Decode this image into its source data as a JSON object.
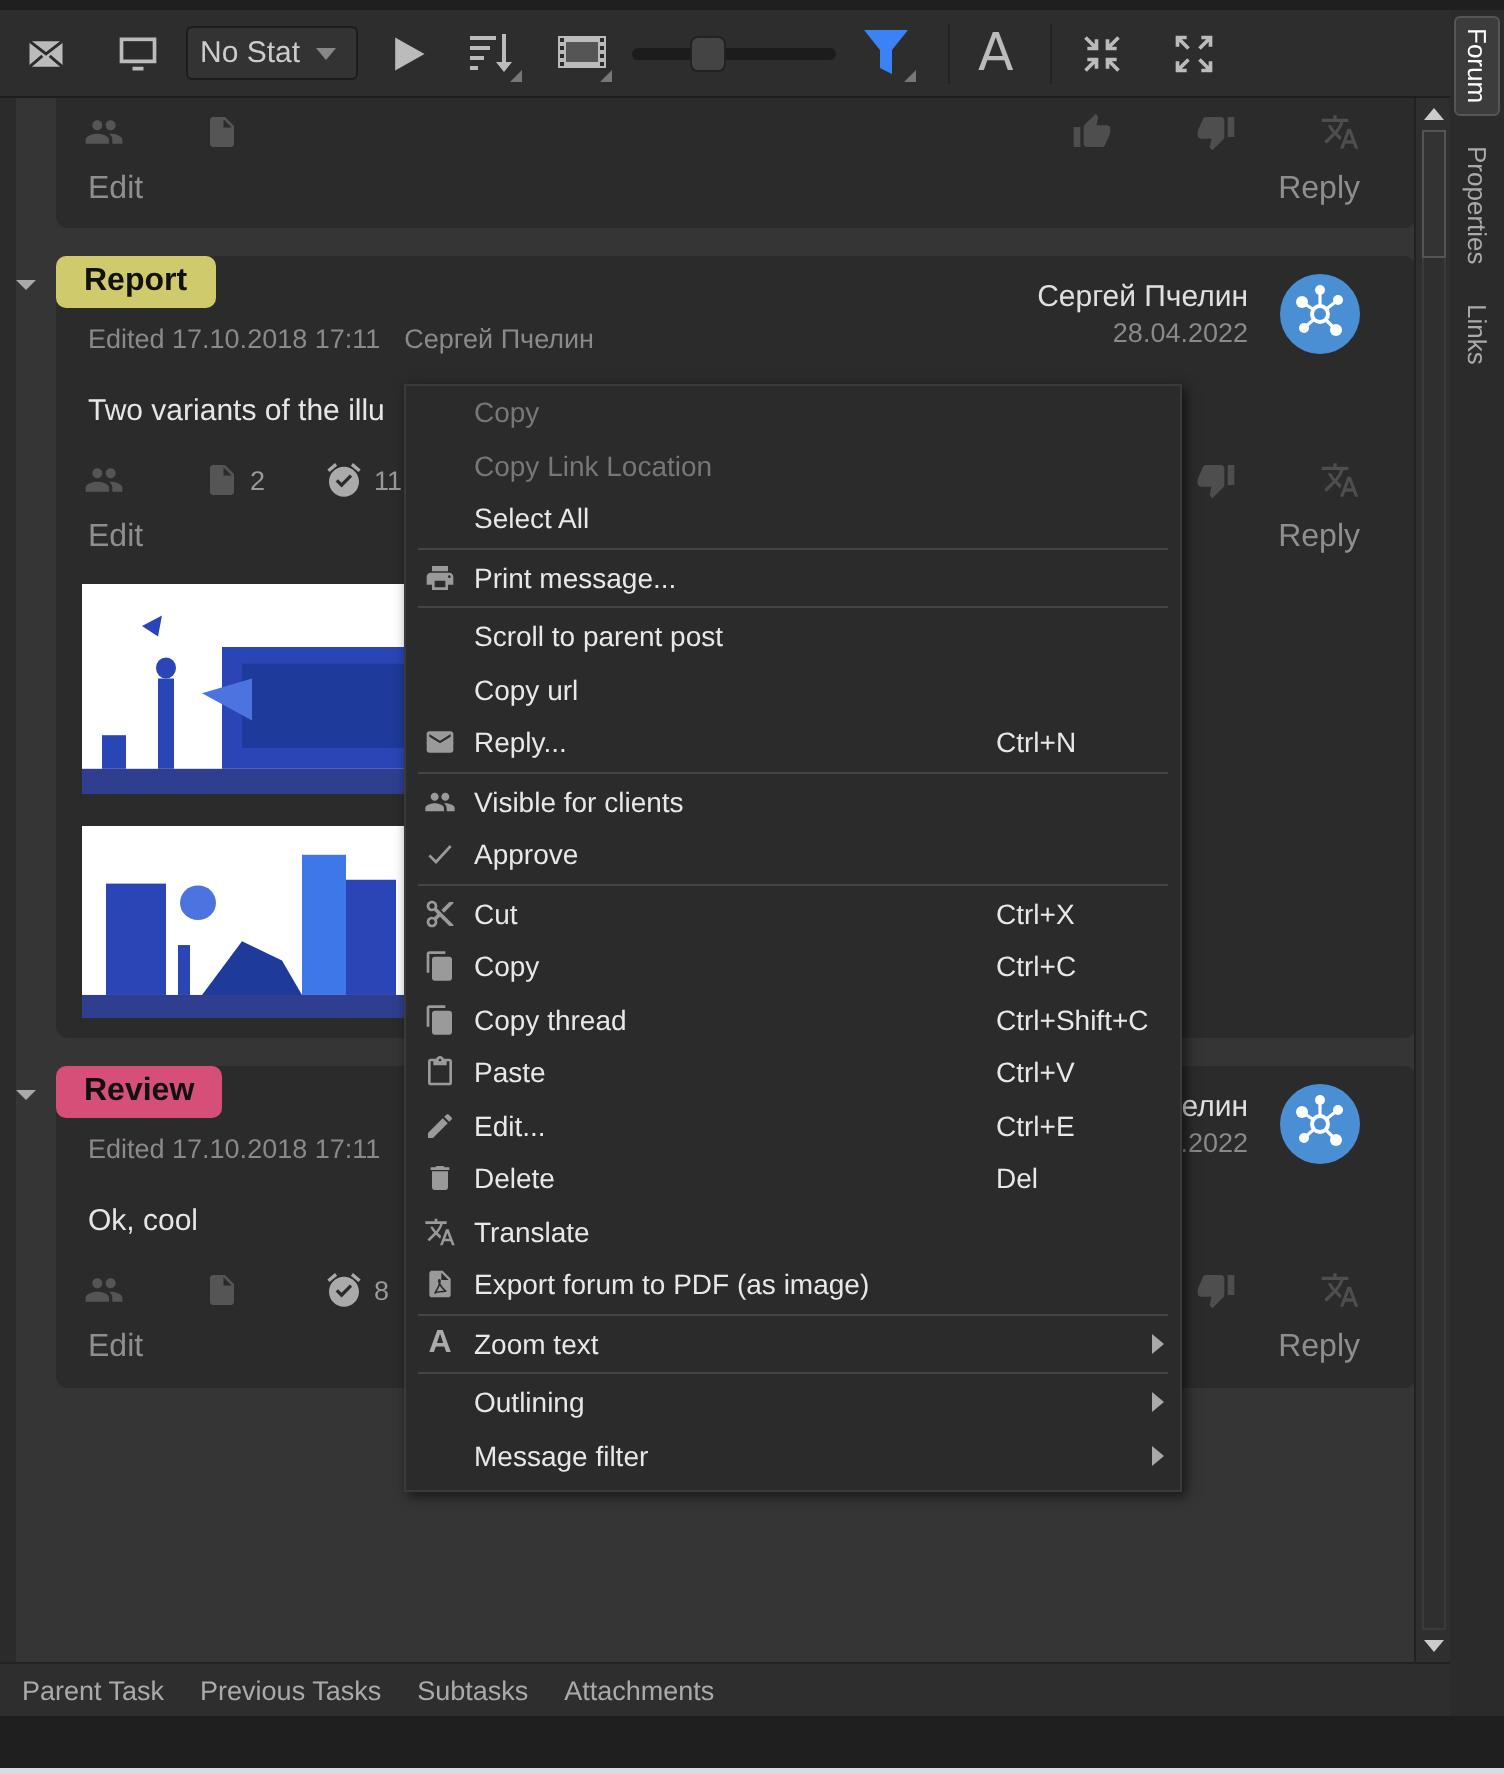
{
  "toolbar": {
    "status_dropdown": {
      "value": "No Stat"
    },
    "zoom_slider": {
      "level": 0.36
    },
    "font_button": "A"
  },
  "side_tabs": [
    {
      "label": "Forum",
      "selected": true
    },
    {
      "label": "Properties",
      "selected": false
    },
    {
      "label": "Links",
      "selected": false
    }
  ],
  "posts": [
    {
      "meta": [
        {
          "kind": "people"
        },
        {
          "kind": "doc"
        }
      ],
      "reactions": [
        {
          "kind": "thumb-up"
        },
        {
          "kind": "thumb-down"
        },
        {
          "kind": "translate"
        }
      ],
      "edit": "Edit",
      "reply": "Reply"
    },
    {
      "expanded": true,
      "tag": {
        "label": "Report",
        "color": "#cfca6b"
      },
      "edited": "Edited 17.10.2018 17:11",
      "editor": "Сергей Пчелин",
      "author": "Сергей Пчелин",
      "date": "28.04.2022",
      "body": "Two variants of the illu",
      "meta": [
        {
          "kind": "people"
        },
        {
          "kind": "doc",
          "count": "2"
        },
        {
          "kind": "alarm",
          "count": "11"
        }
      ],
      "reactions": [
        {
          "kind": "thumb-down"
        },
        {
          "kind": "translate"
        }
      ],
      "edit": "Edit",
      "reply": "Reply",
      "images": [
        {
          "kind": "picture"
        },
        {
          "kind": "picture"
        }
      ]
    },
    {
      "expanded": true,
      "tag": {
        "label": "Review",
        "color": "#d54f78"
      },
      "edited": "Edited 17.10.2018 17:11",
      "author": "елин",
      "date": ".2022",
      "body": "Ok, cool",
      "meta": [
        {
          "kind": "people"
        },
        {
          "kind": "doc"
        },
        {
          "kind": "alarm",
          "count": "8"
        }
      ],
      "reactions": [
        {
          "kind": "thumb-down"
        },
        {
          "kind": "translate"
        }
      ],
      "edit": "Edit",
      "reply": "Reply"
    }
  ],
  "context_menu": {
    "items": [
      {
        "label": "Copy",
        "disabled": true
      },
      {
        "label": "Copy Link Location",
        "disabled": true
      },
      {
        "label": "Select All",
        "disabled": false,
        "separator_after": true
      },
      {
        "label": "Print message...",
        "kind": "printer",
        "disabled": false,
        "separator_after": true
      },
      {
        "label": "Scroll to parent post",
        "disabled": false
      },
      {
        "label": "Copy url",
        "disabled": false
      },
      {
        "label": "Reply...",
        "kind": "mail",
        "shortcut": "Ctrl+N",
        "disabled": false,
        "separator_after": true
      },
      {
        "label": "Visible for clients",
        "kind": "people",
        "disabled": false
      },
      {
        "label": "Approve",
        "kind": "check",
        "disabled": false,
        "separator_after": true
      },
      {
        "label": "Cut",
        "kind": "scissors",
        "shortcut": "Ctrl+X",
        "disabled": false
      },
      {
        "label": "Copy",
        "kind": "copy",
        "shortcut": "Ctrl+C",
        "disabled": false
      },
      {
        "label": "Copy thread",
        "kind": "copy",
        "shortcut": "Ctrl+Shift+C",
        "disabled": false
      },
      {
        "label": "Paste",
        "kind": "paste",
        "shortcut": "Ctrl+V",
        "disabled": false
      },
      {
        "label": "Edit...",
        "kind": "pencil",
        "shortcut": "Ctrl+E",
        "disabled": false
      },
      {
        "label": "Delete",
        "kind": "trash",
        "shortcut": "Del",
        "disabled": false
      },
      {
        "label": "Translate",
        "kind": "translate",
        "disabled": false
      },
      {
        "label": "Export forum to PDF (as image)",
        "kind": "pdf",
        "disabled": false,
        "separator_after": true
      },
      {
        "label": "Zoom text",
        "glyph": "A",
        "submenu": true,
        "disabled": false,
        "separator_after": true
      },
      {
        "label": "Outlining",
        "submenu": true,
        "disabled": false
      },
      {
        "label": "Message filter",
        "submenu": true,
        "disabled": false
      }
    ]
  },
  "bottom_tabs": [
    {
      "label": "Parent Task",
      "selected": false
    },
    {
      "label": "Previous Tasks",
      "selected": false
    },
    {
      "label": "Subtasks",
      "selected": false
    },
    {
      "label": "Attachments",
      "selected": false
    }
  ]
}
